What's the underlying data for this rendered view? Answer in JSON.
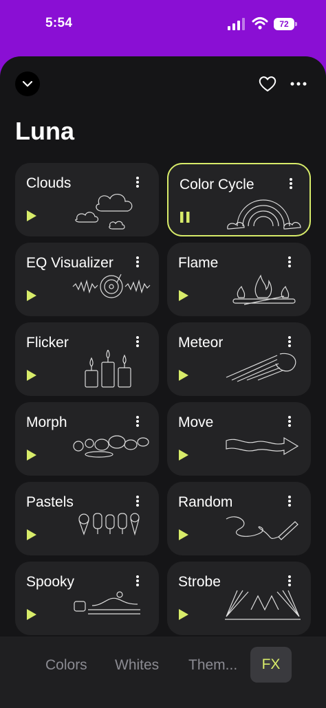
{
  "status_bar": {
    "time": "5:54",
    "battery": "72"
  },
  "header": {
    "title": "Luna"
  },
  "effects": [
    {
      "name": "Clouds",
      "state": "paused",
      "art": "clouds-icon"
    },
    {
      "name": "Color Cycle",
      "state": "playing",
      "art": "rainbow-icon"
    },
    {
      "name": "EQ Visualizer",
      "state": "paused",
      "art": "record-icon"
    },
    {
      "name": "Flame",
      "state": "paused",
      "art": "campfire-icon"
    },
    {
      "name": "Flicker",
      "state": "paused",
      "art": "candles-icon"
    },
    {
      "name": "Meteor",
      "state": "paused",
      "art": "meteor-icon"
    },
    {
      "name": "Morph",
      "state": "paused",
      "art": "blobs-icon"
    },
    {
      "name": "Move",
      "state": "paused",
      "art": "arrow-icon"
    },
    {
      "name": "Pastels",
      "state": "paused",
      "art": "icecream-icon"
    },
    {
      "name": "Random",
      "state": "paused",
      "art": "scribble-icon"
    },
    {
      "name": "Spooky",
      "state": "paused",
      "art": "ghost-train-icon"
    },
    {
      "name": "Strobe",
      "state": "paused",
      "art": "lights-icon"
    }
  ],
  "bottom_tabs": [
    {
      "label": "Colors",
      "active": false
    },
    {
      "label": "Whites",
      "active": false
    },
    {
      "label": "Them...",
      "active": false
    },
    {
      "label": "FX",
      "active": true
    }
  ],
  "colors": {
    "accent": "#d8ec6a",
    "status_bar_bg": "#8a0fd4",
    "sheet_bg": "#151517",
    "card_bg": "#232325"
  }
}
